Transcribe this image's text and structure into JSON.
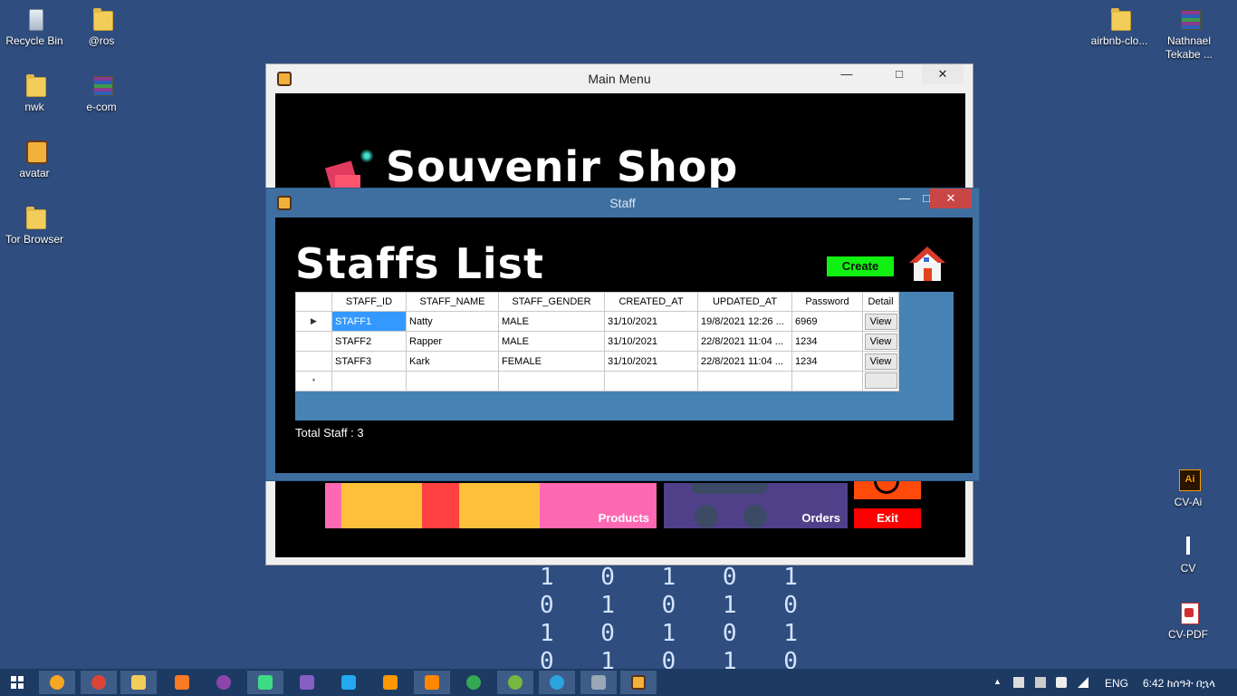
{
  "desktop": {
    "icons": [
      {
        "label": "Recycle Bin",
        "icon": "recycle-bin-icon"
      },
      {
        "label": "@ros",
        "icon": "folder-icon"
      },
      {
        "label": "nwk",
        "icon": "folder-icon"
      },
      {
        "label": "e-com",
        "icon": "winrar-archive-icon"
      },
      {
        "label": "avatar",
        "icon": "avatar-image-icon"
      },
      {
        "label": "Tor Browser",
        "icon": "folder-icon"
      },
      {
        "label": "airbnb-clo...",
        "icon": "folder-icon"
      },
      {
        "label": "Nathnael Tekabe ...",
        "icon": "winrar-archive-icon"
      },
      {
        "label": "CV-Ai",
        "icon": "illustrator-file-icon"
      },
      {
        "label": "CV",
        "icon": "document-icon"
      },
      {
        "label": "CV-PDF",
        "icon": "pdf-file-icon"
      }
    ],
    "binary_rows": [
      "1 0 1 0 1",
      "0 1 0 1 0",
      "1 0 1 0 1",
      "0 1 0 1 0"
    ]
  },
  "main_window": {
    "title": "Main Menu",
    "shop_title": "Souvenir Shop",
    "tiles": {
      "products": "Products",
      "orders": "Orders",
      "exit": "Exit"
    },
    "products_colors": [
      "#ff69b4",
      "#ffc13b",
      "#ff4040",
      "#ffc13b",
      "#ff69b4"
    ]
  },
  "staff_window": {
    "title": "Staff",
    "heading": "Staffs List",
    "create_label": "Create",
    "columns": [
      "STAFF_ID",
      "STAFF_NAME",
      "STAFF_GENDER",
      "CREATED_AT",
      "UPDATED_AT",
      "Password",
      "Detail"
    ],
    "rows": [
      {
        "id": "STAFF1",
        "name": "Natty",
        "gender": "MALE",
        "created": "31/10/2021",
        "updated": "19/8/2021 12:26 ...",
        "password": "6969",
        "detail": "View"
      },
      {
        "id": "STAFF2",
        "name": "Rapper",
        "gender": "MALE",
        "created": "31/10/2021",
        "updated": "22/8/2021 11:04 ...",
        "password": "1234",
        "detail": "View"
      },
      {
        "id": "STAFF3",
        "name": "Kark",
        "gender": "FEMALE",
        "created": "31/10/2021",
        "updated": "22/8/2021 11:04 ...",
        "password": "1234",
        "detail": "View"
      }
    ],
    "new_row_marker": "*",
    "current_row_marker": "▶",
    "total_label": "Total Staff : 3"
  },
  "taskbar": {
    "apps": [
      "search-app",
      "chrome",
      "file-explorer",
      "xampp",
      "github-desktop",
      "android-studio",
      "visual-studio",
      "vs-code",
      "sublime-text",
      "vlc",
      "chrome-alt",
      "utorrent",
      "telegram",
      "remote-desktop",
      "souvenir-shop-app"
    ],
    "language": "ENG",
    "clock": "6:42 ከሰዓት በኋላ"
  },
  "colors": {
    "desktop_bg": "#2f4d7e",
    "create_button": "#11f111",
    "grid_panel": "#4682b4",
    "selection": "#3399ff",
    "exit_button": "#ff0000"
  }
}
